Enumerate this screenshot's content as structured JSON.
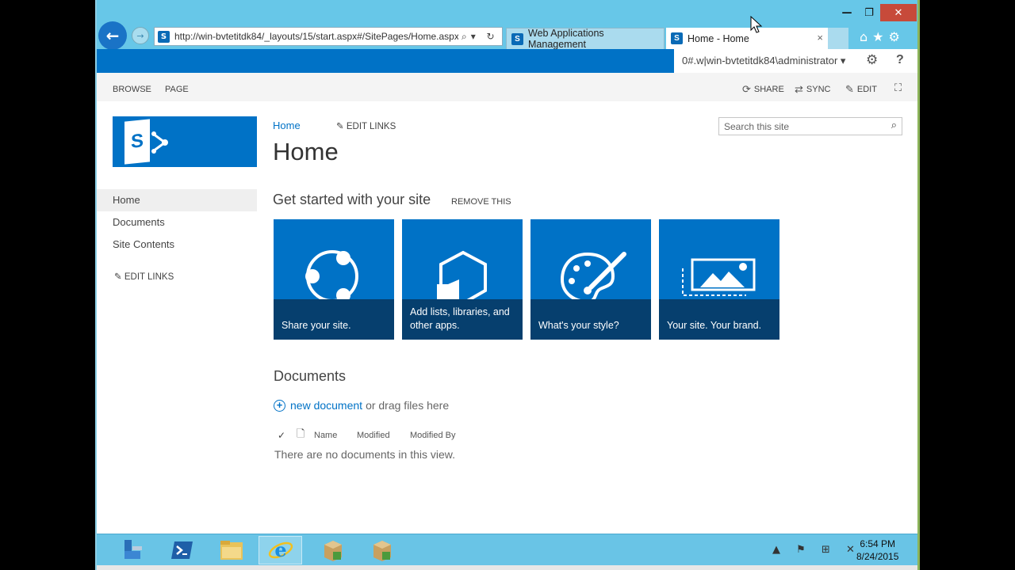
{
  "window": {
    "minimize": "—",
    "maximize": "❐",
    "close": "✕"
  },
  "browser": {
    "address": "http://win-bvtetitdk84/_layouts/15/start.aspx#/SitePages/Home.aspx",
    "address_icons": "⌕▾ ↻",
    "tabs": [
      {
        "label": "Web Applications Management"
      },
      {
        "label": "Home - Home"
      }
    ],
    "tab_close": "×",
    "toolbar_icons": "⌂★⚙"
  },
  "suite": {
    "user": "0#.w|win-bvtetitdk84\\administrator ▾",
    "settings": "⚙",
    "help": "?"
  },
  "ribbon": {
    "tabs": [
      "BROWSE",
      "PAGE"
    ],
    "share": "SHARE",
    "sync": "SYNC",
    "edit": "EDIT"
  },
  "nav": {
    "items": [
      "Home",
      "Documents",
      "Site Contents"
    ],
    "edit_links": "EDIT LINKS"
  },
  "header": {
    "breadcrumb": "Home",
    "edit_links": "EDIT LINKS",
    "title": "Home",
    "search_placeholder": "Search this site"
  },
  "getting_started": {
    "title": "Get started with your site",
    "remove": "REMOVE THIS",
    "tiles": [
      {
        "label": "Share your site.",
        "icon": "share-icon"
      },
      {
        "label": "Add lists, libraries, and other apps.",
        "icon": "apps-hexagon-icon"
      },
      {
        "label": "What's your style?",
        "icon": "palette-icon"
      },
      {
        "label": "Your site. Your brand.",
        "icon": "picture-icon"
      }
    ]
  },
  "documents": {
    "title": "Documents",
    "new_link": "new document",
    "new_rest": "or drag files here",
    "columns": [
      "Name",
      "Modified",
      "Modified By"
    ],
    "empty": "There are no documents in this view."
  },
  "taskbar": {
    "time": "6:54 PM",
    "date": "8/24/2015",
    "tray": "▲ ⚑ ⊞ ✕"
  },
  "colors": {
    "sharepoint_blue": "#0072c6",
    "tile_caption": "#063f6e",
    "ie_chrome": "#67c7e8"
  }
}
